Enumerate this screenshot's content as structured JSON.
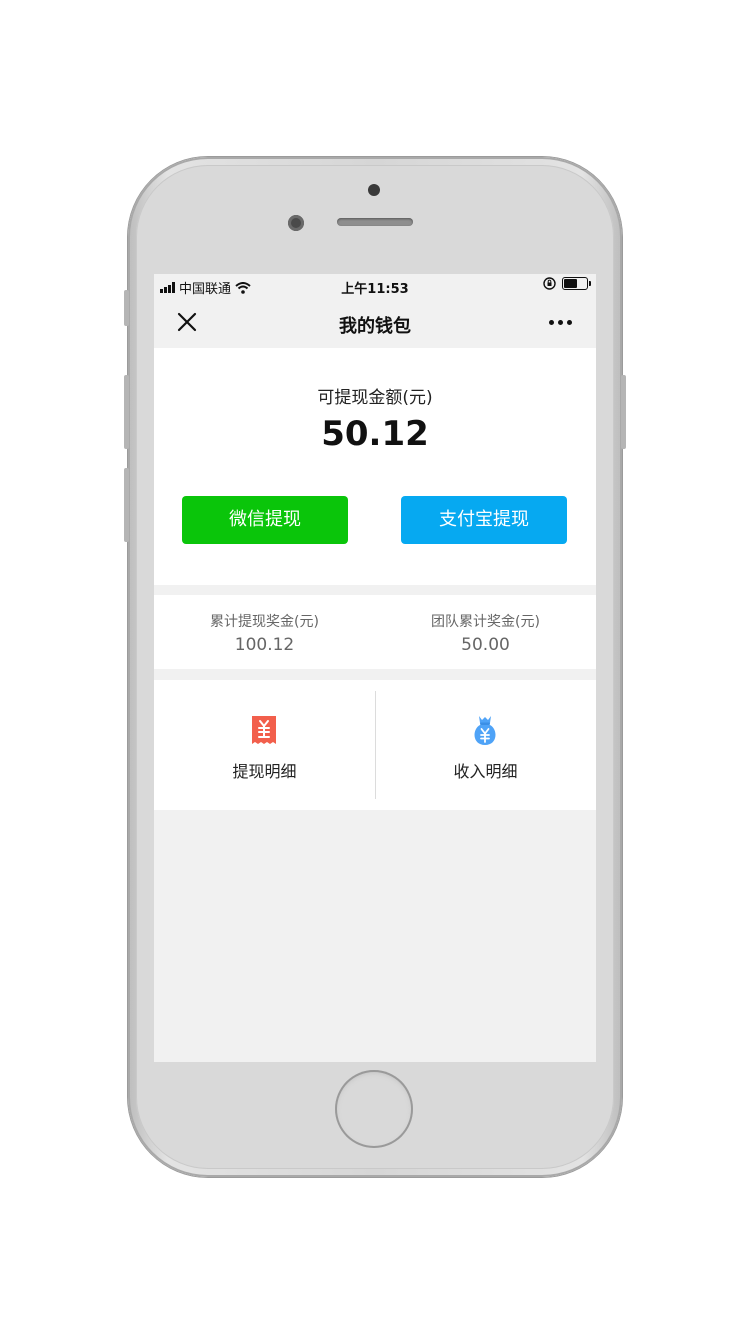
{
  "status_bar": {
    "carrier": "中国联通",
    "time": "上午11:53"
  },
  "navbar": {
    "title": "我的钱包",
    "close_icon": "close-icon",
    "more_icon": "more-icon"
  },
  "balance": {
    "label": "可提现金额(元)",
    "amount": "50.12"
  },
  "buttons": {
    "wechat_withdraw": "微信提现",
    "alipay_withdraw": "支付宝提现"
  },
  "stats": [
    {
      "label": "累计提现奖金(元)",
      "value": "100.12"
    },
    {
      "label": "团队累计奖金(元)",
      "value": "50.00"
    }
  ],
  "menu": [
    {
      "label": "提现明细",
      "icon": "withdraw-record-icon"
    },
    {
      "label": "收入明细",
      "icon": "money-bag-icon"
    }
  ],
  "colors": {
    "wechat_green": "#0ac50a",
    "alipay_blue": "#06a9f1",
    "withdraw_icon": "#f25f4c",
    "income_icon": "#4fa3f7"
  }
}
